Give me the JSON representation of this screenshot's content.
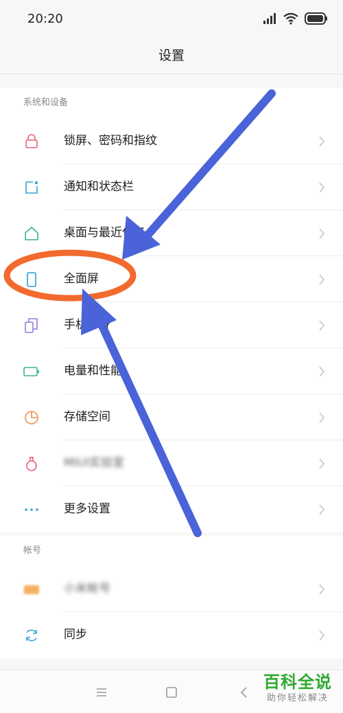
{
  "status": {
    "time": "20:20"
  },
  "title": "设置",
  "section_system": {
    "header": "系统和设备",
    "items": [
      {
        "label": "锁屏、密码和指纹",
        "icon": "lock-icon",
        "color": "#e8607a"
      },
      {
        "label": "通知和状态栏",
        "icon": "notification-icon",
        "color": "#3aa3d9"
      },
      {
        "label": "桌面与最近任务",
        "icon": "home-icon",
        "color": "#36b58a"
      },
      {
        "label": "全面屏",
        "icon": "phone-screen-icon",
        "color": "#2d9bd6"
      },
      {
        "label": "手机分身",
        "icon": "dual-phone-icon",
        "color": "#9a7ad8"
      },
      {
        "label": "电量和性能",
        "icon": "battery-icon",
        "color": "#36b58a"
      },
      {
        "label": "存储空间",
        "icon": "storage-pie-icon",
        "color": "#f08f4f"
      },
      {
        "label": "MIUI实验室",
        "icon": "lab-flask-icon",
        "color": "#e8607a"
      },
      {
        "label": "更多设置",
        "icon": "more-dots-icon",
        "color": "#3aa3d9"
      }
    ]
  },
  "section_account": {
    "header": "帐号",
    "items": [
      {
        "label": "小米帐号",
        "icon": "account-icon",
        "color": "#f4b060"
      },
      {
        "label": "同步",
        "icon": "sync-icon",
        "color": "#3aa3d9"
      }
    ]
  },
  "watermark": {
    "main": "百科全说",
    "sub": "助你轻松解决"
  },
  "annotation_colors": {
    "arrow": "#4a63d8",
    "ellipse": "#f26a2e"
  }
}
